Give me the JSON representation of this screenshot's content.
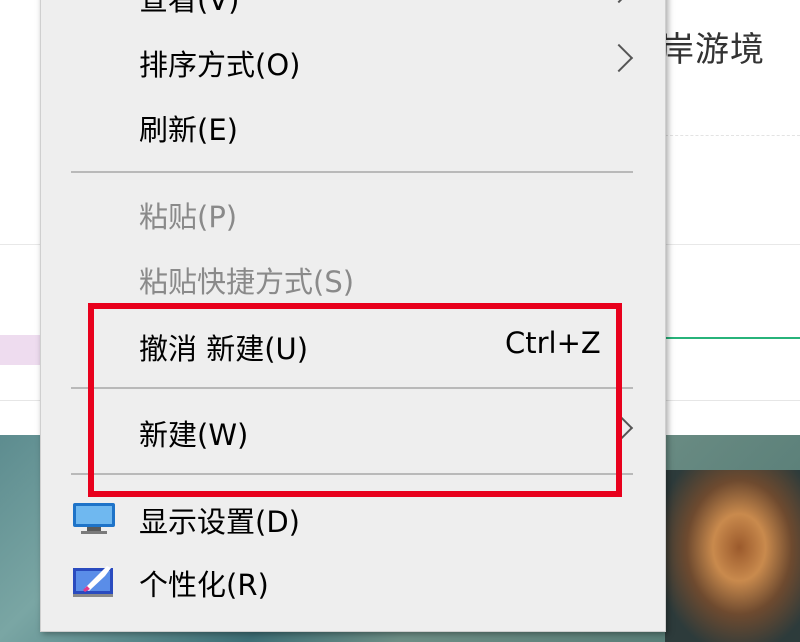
{
  "background": {
    "window_title_fragment": "岸游境"
  },
  "menu": {
    "items": [
      {
        "label": "查看(V)",
        "has_submenu": true,
        "enabled": true
      },
      {
        "label": "排序方式(O)",
        "has_submenu": true,
        "enabled": true
      },
      {
        "label": "刷新(E)",
        "has_submenu": false,
        "enabled": true
      },
      {
        "label": "粘贴(P)",
        "has_submenu": false,
        "enabled": false
      },
      {
        "label": "粘贴快捷方式(S)",
        "has_submenu": false,
        "enabled": false
      },
      {
        "label": "撤消 新建(U)",
        "shortcut": "Ctrl+Z",
        "has_submenu": false,
        "enabled": true
      },
      {
        "label": "新建(W)",
        "has_submenu": true,
        "enabled": true
      },
      {
        "label": "显示设置(D)",
        "icon": "display-settings-icon",
        "enabled": true
      },
      {
        "label": "个性化(R)",
        "icon": "personalize-icon",
        "enabled": true
      }
    ]
  },
  "annotation": {
    "highlight_color": "#e8001c"
  }
}
